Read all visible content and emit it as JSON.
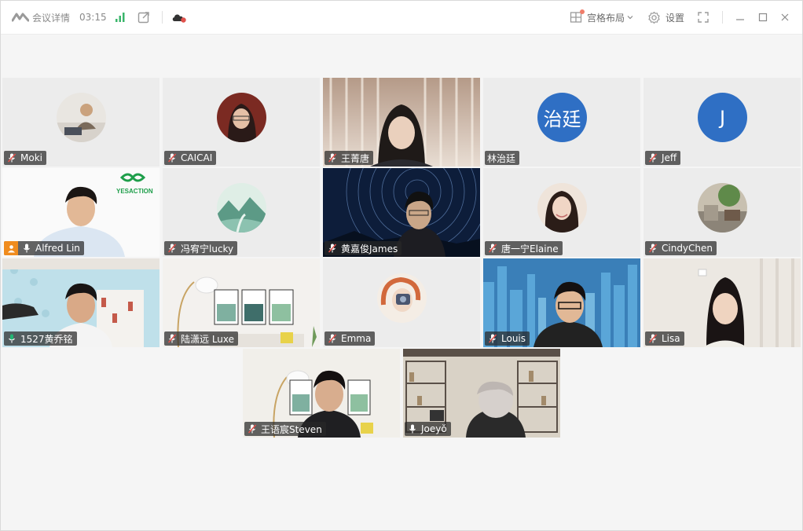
{
  "titlebar": {
    "app_label": "会议详情",
    "timer": "03:15",
    "layout_label": "宫格布局",
    "settings_label": "设置"
  },
  "tiles": [
    {
      "name": "Moki",
      "mic": "muted",
      "kind": "photo-avatar"
    },
    {
      "name": "CAICAI",
      "mic": "muted",
      "kind": "photo-avatar"
    },
    {
      "name": "王菁唐",
      "mic": "muted",
      "kind": "video"
    },
    {
      "name": "林治廷",
      "mic": "none",
      "kind": "text-avatar",
      "avatar_text": "治廷"
    },
    {
      "name": "Jeff",
      "mic": "muted",
      "kind": "text-avatar",
      "avatar_text": "J"
    },
    {
      "name": "Alfred Lin",
      "mic": "on",
      "kind": "video",
      "host": true,
      "overlay_text": "YESACTION"
    },
    {
      "name": "冯宥宁lucky",
      "mic": "muted",
      "kind": "photo-avatar"
    },
    {
      "name": "黄嘉俊James",
      "mic": "muted",
      "kind": "video"
    },
    {
      "name": "唐一宁Elaine",
      "mic": "muted",
      "kind": "photo-avatar"
    },
    {
      "name": "CindyChen",
      "mic": "muted",
      "kind": "photo-avatar"
    },
    {
      "name": "1527黄乔铭",
      "mic": "speaking",
      "kind": "video",
      "active": true
    },
    {
      "name": "陆潇远 Luxe",
      "mic": "muted",
      "kind": "video"
    },
    {
      "name": "Emma",
      "mic": "muted",
      "kind": "photo-avatar"
    },
    {
      "name": "Louis",
      "mic": "muted",
      "kind": "video"
    },
    {
      "name": "Lisa",
      "mic": "muted",
      "kind": "video"
    },
    {
      "name": "王语宸Steven",
      "mic": "muted",
      "kind": "video"
    },
    {
      "name": "Joeyŏ",
      "mic": "on",
      "kind": "video"
    }
  ],
  "colors": {
    "active_border": "#22b573",
    "host_badge": "#f08c1e",
    "text_avatar_bg": "#2f6fc4",
    "muted_icon": "#e0524c"
  }
}
